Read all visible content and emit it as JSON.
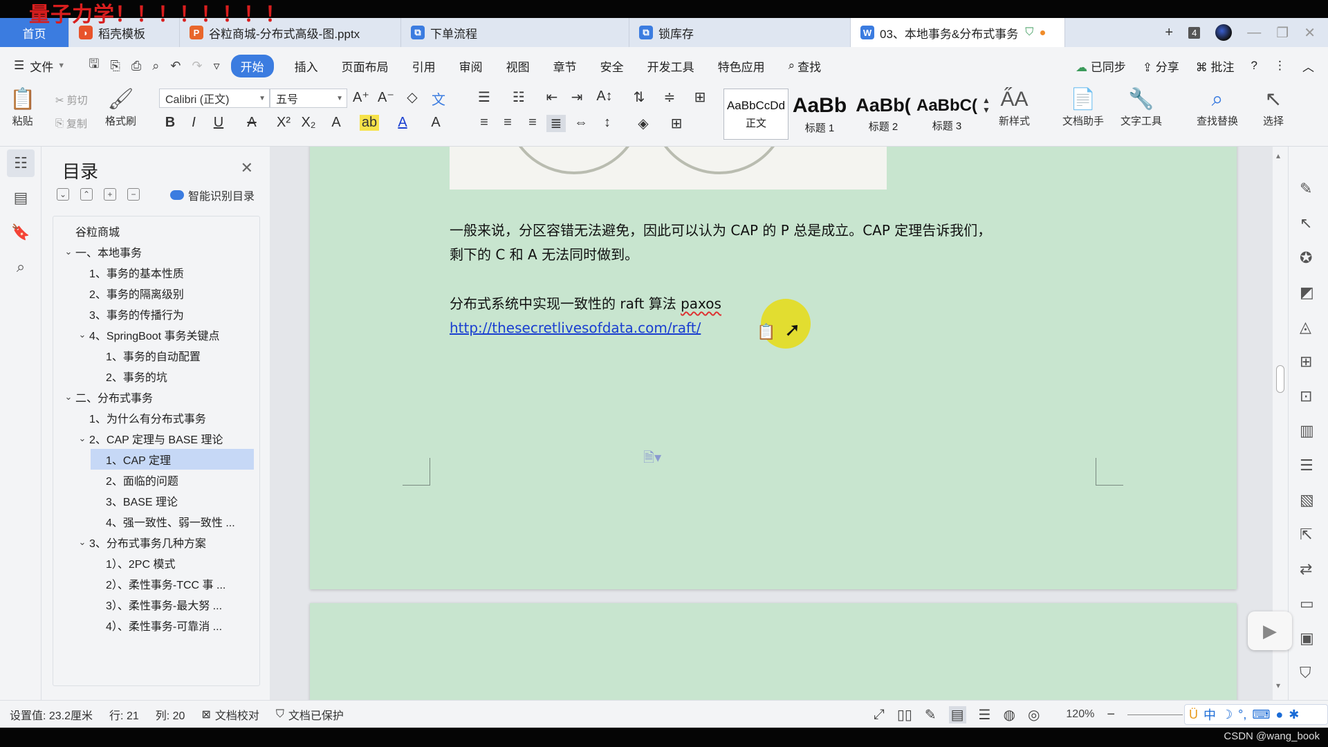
{
  "watermark": "量子力学！！！！！！！！",
  "tabs": [
    {
      "label": "首页",
      "icon": "home"
    },
    {
      "label": "稻壳模板",
      "icon": "docer-icon",
      "color": "#e8532b"
    },
    {
      "label": "谷粒商城-分布式高级-图.pptx",
      "icon": "pptx-icon",
      "color": "#e8662b"
    },
    {
      "label": "下单流程",
      "icon": "flow-icon",
      "color": "#3b7ce0"
    },
    {
      "label": "锁库存",
      "icon": "flow-icon",
      "color": "#3b7ce0"
    },
    {
      "label": "03、本地事务&分布式事务",
      "icon": "word-icon",
      "color": "#3b7ce0"
    }
  ],
  "tab_count": "4",
  "menu": {
    "file": "文件",
    "items": [
      "开始",
      "插入",
      "页面布局",
      "引用",
      "审阅",
      "视图",
      "章节",
      "安全",
      "开发工具",
      "特色应用"
    ],
    "active": "开始",
    "search": "查找",
    "synced": "已同步",
    "share": "分享",
    "comment": "批注"
  },
  "ribbon": {
    "paste": "粘贴",
    "cut": "剪切",
    "copy": "复制",
    "format_painter": "格式刷",
    "font_name": "Calibri (正文)",
    "font_size": "五号",
    "styles": [
      {
        "preview": "AaBbCcDd",
        "label": "正文"
      },
      {
        "preview": "AaBb",
        "label": "标题 1"
      },
      {
        "preview": "AaBb(",
        "label": "标题 2"
      },
      {
        "preview": "AaBbC(",
        "label": "标题 3"
      }
    ],
    "new_style": "新样式",
    "doc_assistant": "文档助手",
    "text_tools": "文字工具",
    "find_replace": "查找替换",
    "select": "选择"
  },
  "toc": {
    "title": "目录",
    "smart": "智能识别目录",
    "items": [
      {
        "text": "谷粒商城",
        "level": 0,
        "caret": ""
      },
      {
        "text": "一、本地事务",
        "level": 0,
        "caret": "v"
      },
      {
        "text": "1、事务的基本性质",
        "level": 1,
        "caret": ""
      },
      {
        "text": "2、事务的隔离级别",
        "level": 1,
        "caret": ""
      },
      {
        "text": "3、事务的传播行为",
        "level": 1,
        "caret": ""
      },
      {
        "text": "4、SpringBoot 事务关键点",
        "level": 1,
        "caret": "v"
      },
      {
        "text": "1、事务的自动配置",
        "level": 2,
        "caret": ""
      },
      {
        "text": "2、事务的坑",
        "level": 2,
        "caret": ""
      },
      {
        "text": "二、分布式事务",
        "level": 0,
        "caret": "v"
      },
      {
        "text": "1、为什么有分布式事务",
        "level": 1,
        "caret": ""
      },
      {
        "text": "2、CAP 定理与 BASE 理论",
        "level": 1,
        "caret": "v"
      },
      {
        "text": "1、CAP 定理",
        "level": 2,
        "caret": "",
        "selected": true
      },
      {
        "text": "2、面临的问题",
        "level": 2,
        "caret": ""
      },
      {
        "text": "3、BASE 理论",
        "level": 2,
        "caret": ""
      },
      {
        "text": "4、强一致性、弱一致性 ...",
        "level": 2,
        "caret": ""
      },
      {
        "text": "3、分布式事务几种方案",
        "level": 1,
        "caret": "v"
      },
      {
        "text": "1）、2PC 模式",
        "level": 2,
        "caret": ""
      },
      {
        "text": "2）、柔性事务-TCC 事 ...",
        "level": 2,
        "caret": ""
      },
      {
        "text": "3）、柔性事务-最大努 ...",
        "level": 2,
        "caret": ""
      },
      {
        "text": "4）、柔性事务-可靠消 ...",
        "level": 2,
        "caret": ""
      }
    ]
  },
  "document": {
    "para1_line1": "一般来说，分区容错无法避免，因此可以认为 CAP 的 P 总是成立。CAP 定理告诉我们，",
    "para1_line2": "剩下的 C 和 A 无法同时做到。",
    "para2_text": "分布式系统中实现一致性的 raft 算法",
    "para2_word": "paxos",
    "link": "http://thesecretlivesofdata.com/raft/"
  },
  "status": {
    "setting": "设置值: 23.2厘米",
    "row": "行: 21",
    "col": "列: 20",
    "proof": "文档校对",
    "protected": "文档已保护",
    "zoom": "120%"
  },
  "ime": "中",
  "credit": "CSDN @wang_book"
}
